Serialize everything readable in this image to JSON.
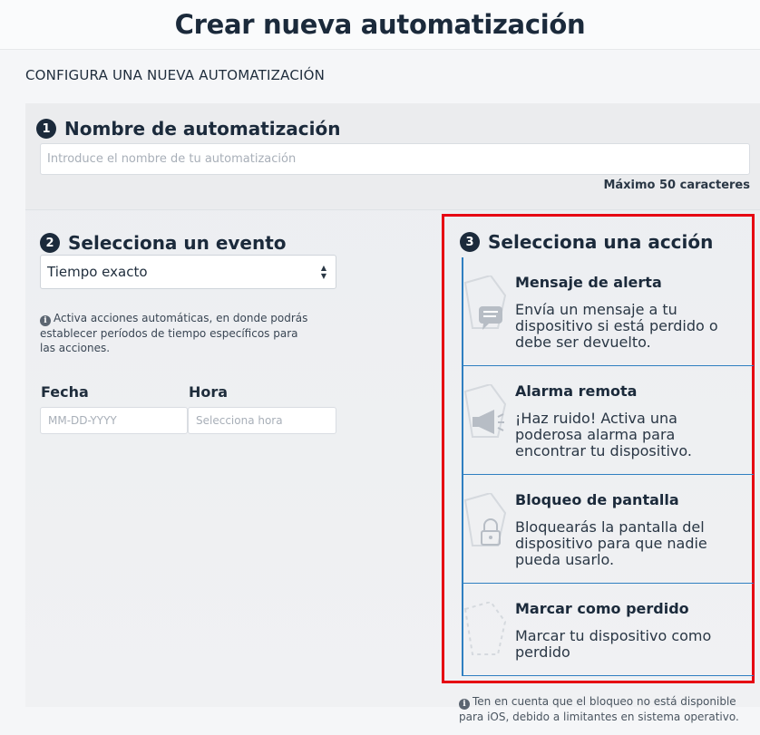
{
  "page_title": "Crear nueva automatización",
  "section_label": "CONFIGURA UNA NUEVA AUTOMATIZACIÓN",
  "name_step": {
    "number": "1",
    "title": "Nombre de automatización",
    "placeholder": "Introduce el nombre de tu automatización",
    "value": "",
    "max_note": "Máximo 50 caracteres"
  },
  "event_step": {
    "number": "2",
    "title": "Selecciona un evento",
    "selected": "Tiempo exacto",
    "options": [
      "Tiempo exacto"
    ],
    "info": "Activa acciones automáticas, en donde podrás establecer períodos de tiempo específicos para las acciones.",
    "date_label": "Fecha",
    "date_placeholder": "MM-DD-YYYY",
    "time_label": "Hora",
    "time_placeholder": "Selecciona hora"
  },
  "action_step": {
    "number": "3",
    "title": "Selecciona una acción",
    "actions": [
      {
        "title": "Mensaje de alerta",
        "description": "Envía un mensaje a tu dispositivo si está perdido o debe ser devuelto.",
        "icon": "message-bubble-icon"
      },
      {
        "title": "Alarma remota",
        "description": "¡Haz ruido! Activa una poderosa alarma para encontrar tu dispositivo.",
        "icon": "megaphone-icon"
      },
      {
        "title": "Bloqueo de pantalla",
        "description": "Bloquearás la pantalla del dispositivo para que nadie pueda usarlo.",
        "icon": "lock-icon"
      },
      {
        "title": "Marcar como perdido",
        "description": "Marcar tu dispositivo como perdido",
        "icon": "hexagon-dashed-icon"
      }
    ]
  },
  "bottom_note": "Ten en cuenta que el bloqueo no está disponible para iOS, debido a limitantes en sistema operativo.",
  "colors": {
    "highlight_border": "#e60012",
    "accent_blue": "#2f7fc1",
    "dark_navy": "#1b2a3b"
  }
}
